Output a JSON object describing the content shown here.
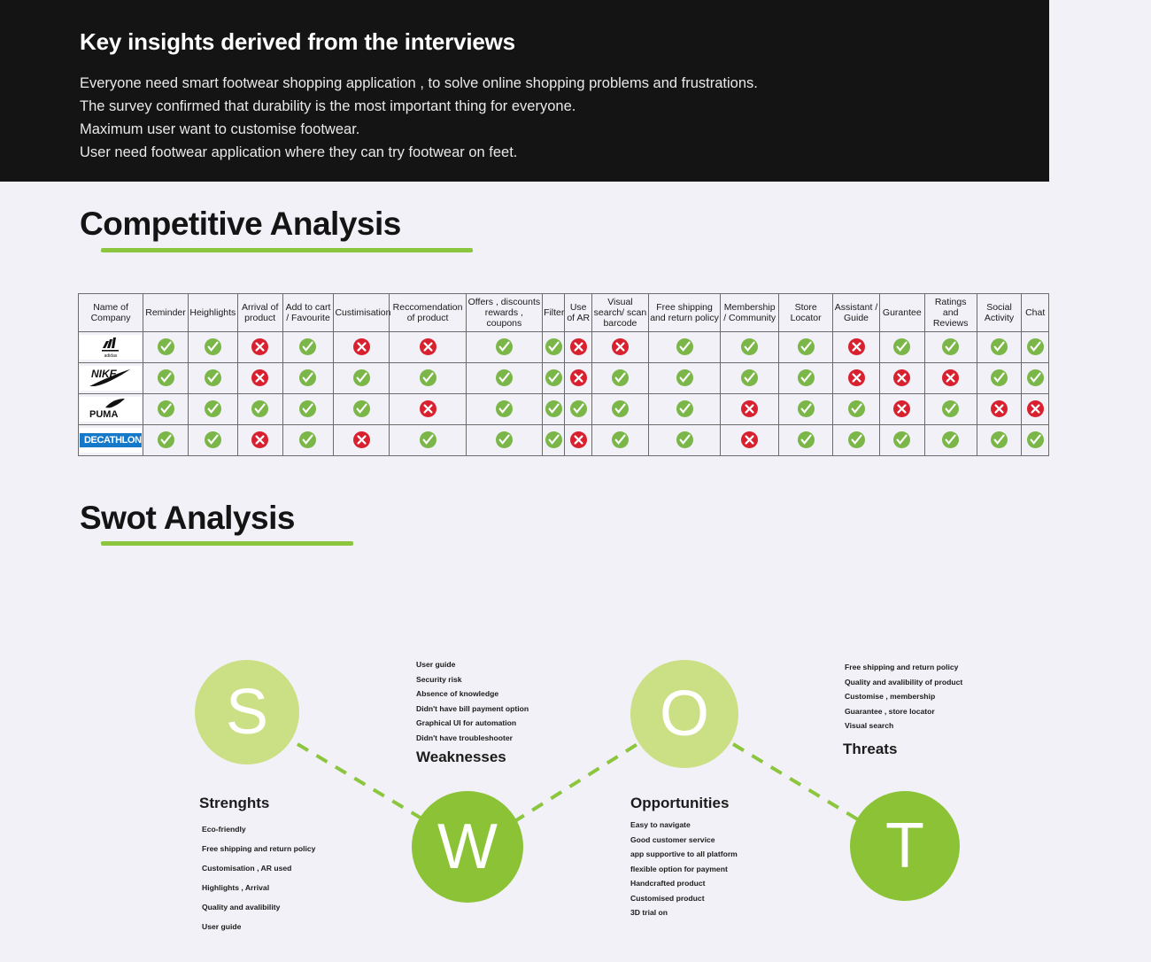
{
  "insights": {
    "title": "Key insights derived from the interviews",
    "lines": [
      "Everyone need smart footwear shopping application , to solve online shopping problems and frustrations.",
      "The survey confirmed that durability is the most important thing for everyone.",
      "Maximum user want to customise footwear.",
      "User need footwear application where they can try footwear on feet."
    ]
  },
  "competitive": {
    "heading": "Competitive Analysis",
    "columns": [
      "Name of Company",
      "Reminder",
      "Heighlights",
      "Arrival of product",
      "Add to cart / Favourite",
      "Custimisation",
      "Reccomendation of product",
      "Offers , discounts rewards , coupons",
      "Filter",
      "Use of AR",
      "Visual search/ scan barcode",
      "Free shipping and return policy",
      "Membership / Community",
      "Store Locator",
      "Assistant / Guide",
      "Gurantee",
      "Ratings and Reviews",
      "Social Activity",
      "Chat"
    ],
    "rows": [
      {
        "company": "adidas",
        "logo_style": "adidas",
        "values": [
          "yes",
          "yes",
          "no",
          "yes",
          "no",
          "no",
          "yes",
          "yes",
          "no",
          "no",
          "yes",
          "yes",
          "yes",
          "no",
          "yes",
          "yes",
          "yes",
          "yes"
        ]
      },
      {
        "company": "NIKE",
        "logo_style": "nike",
        "values": [
          "yes",
          "yes",
          "no",
          "yes",
          "yes",
          "yes",
          "yes",
          "yes",
          "no",
          "yes",
          "yes",
          "yes",
          "yes",
          "no",
          "no",
          "no",
          "yes",
          "yes"
        ]
      },
      {
        "company": "PUMA",
        "logo_style": "puma",
        "values": [
          "yes",
          "yes",
          "yes",
          "yes",
          "yes",
          "no",
          "yes",
          "yes",
          "yes",
          "yes",
          "yes",
          "no",
          "yes",
          "yes",
          "no",
          "yes",
          "no",
          "no"
        ]
      },
      {
        "company": "DECATHLON",
        "logo_style": "decathlon",
        "values": [
          "yes",
          "yes",
          "no",
          "yes",
          "no",
          "yes",
          "yes",
          "yes",
          "no",
          "yes",
          "yes",
          "no",
          "yes",
          "yes",
          "yes",
          "yes",
          "yes",
          "yes"
        ]
      }
    ],
    "legend": {
      "yes": "check-mark",
      "no": "cross-mark"
    }
  },
  "swot": {
    "heading": "Swot Analysis",
    "quadrants": [
      {
        "letter": "S",
        "title": "Strenghts",
        "items": [
          "Eco-friendly",
          "Free shipping and return policy",
          " Customisation , AR used",
          "Highlights , Arrival",
          "Quality and avalibility",
          "User guide"
        ]
      },
      {
        "letter": "W",
        "title": "Weaknesses",
        "items": [
          "User guide",
          "Security risk",
          "Absence of knowledge",
          "Didn't have bill payment option",
          "Graphical UI for automation",
          "Didn't have troubleshooter"
        ]
      },
      {
        "letter": "O",
        "title": "Opportunities",
        "items": [
          "Easy to  navigate",
          "Good customer service",
          "app supportive to all platform",
          "flexible option for payment",
          "Handcrafted product",
          "Customised product",
          "3D trial on"
        ]
      },
      {
        "letter": "T",
        "title": "Threats",
        "items": [
          "Free shipping and return policy",
          "Quality and avalibility of product",
          "Customise , membership",
          "Guarantee , store locator",
          "Visual search"
        ]
      }
    ]
  },
  "colors": {
    "accent_green": "#8cc63e",
    "light_green": "#cbdf84",
    "mid_green": "#8cc336",
    "check_green": "#7ab648",
    "cross_red": "#d8202f",
    "banner_black": "#141414",
    "page_bg": "#f1f1f7"
  }
}
